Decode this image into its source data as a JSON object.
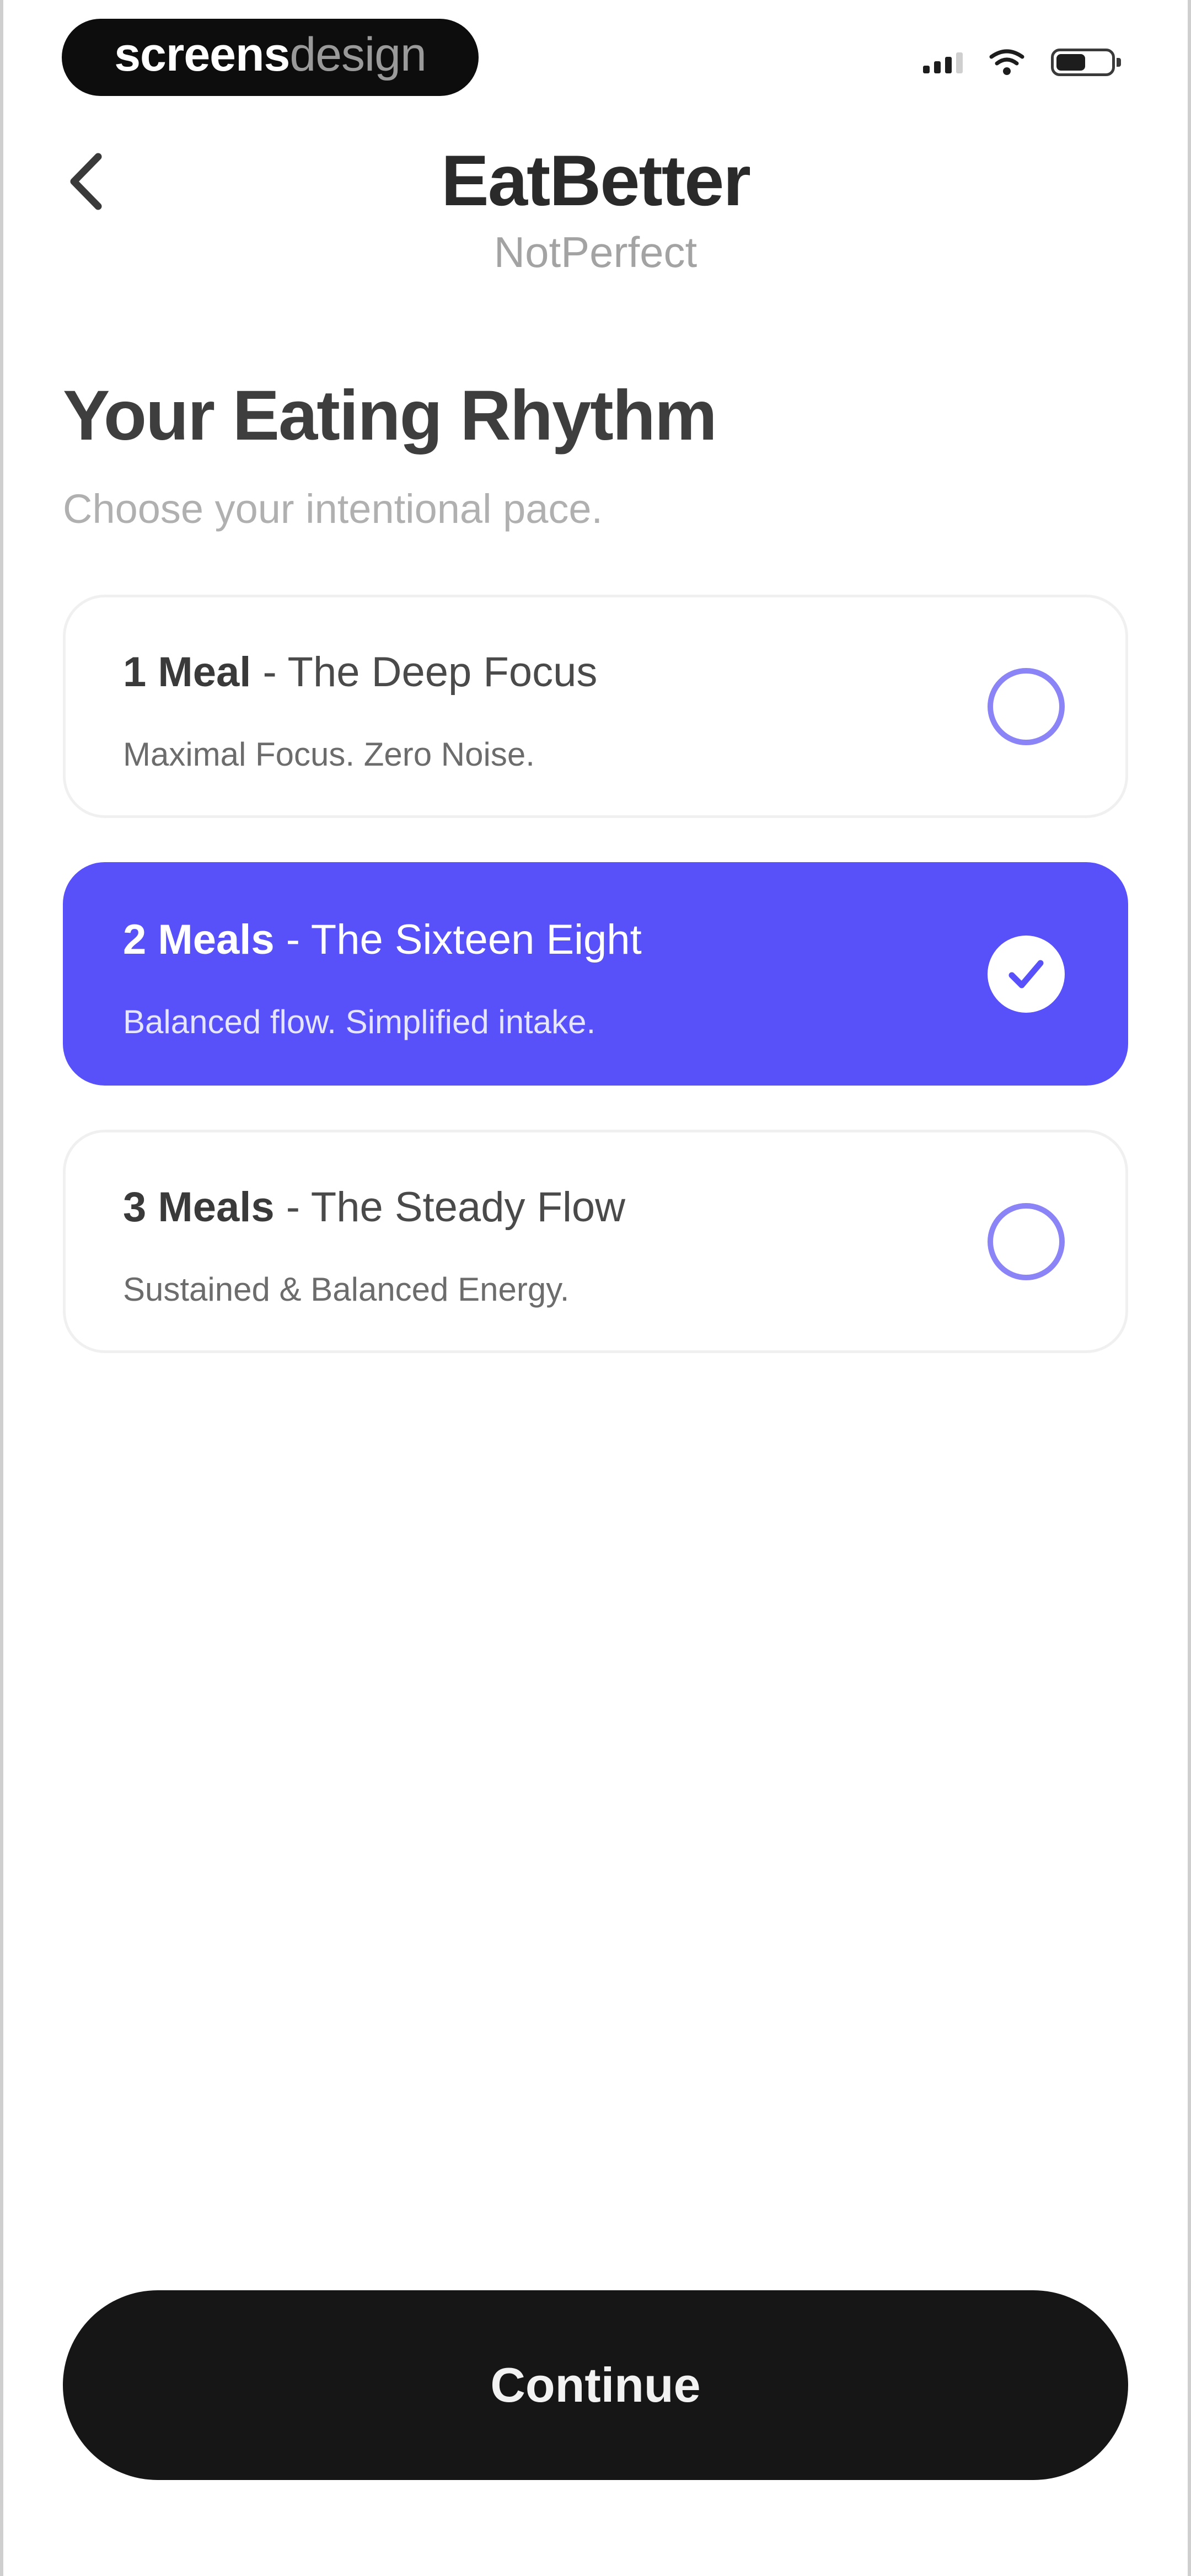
{
  "watermark": {
    "strong": "screens",
    "light": "design"
  },
  "status_bar": {
    "icons": [
      "signal-icon",
      "wifi-icon",
      "battery-icon"
    ]
  },
  "header": {
    "back_icon": "chevron-left-icon",
    "title": "EatBetter",
    "subtitle": "NotPerfect"
  },
  "page": {
    "title": "Your Eating Rhythm",
    "subtitle": "Choose your intentional pace."
  },
  "options": [
    {
      "count": "1 Meal",
      "separator": " - ",
      "name": "The Deep Focus",
      "description": "Maximal Focus. Zero Noise.",
      "selected": false
    },
    {
      "count": "2 Meals",
      "separator": " - ",
      "name": "The Sixteen Eight",
      "description": "Balanced flow. Simplified intake.",
      "selected": true
    },
    {
      "count": "3 Meals",
      "separator": " - ",
      "name": "The Steady Flow",
      "description": "Sustained & Balanced Energy.",
      "selected": false
    }
  ],
  "footer": {
    "continue_label": "Continue"
  },
  "colors": {
    "accent": "#5850f9",
    "radio_ring": "#8b84f6",
    "button_bg": "#161616",
    "background": "#ffffff"
  }
}
